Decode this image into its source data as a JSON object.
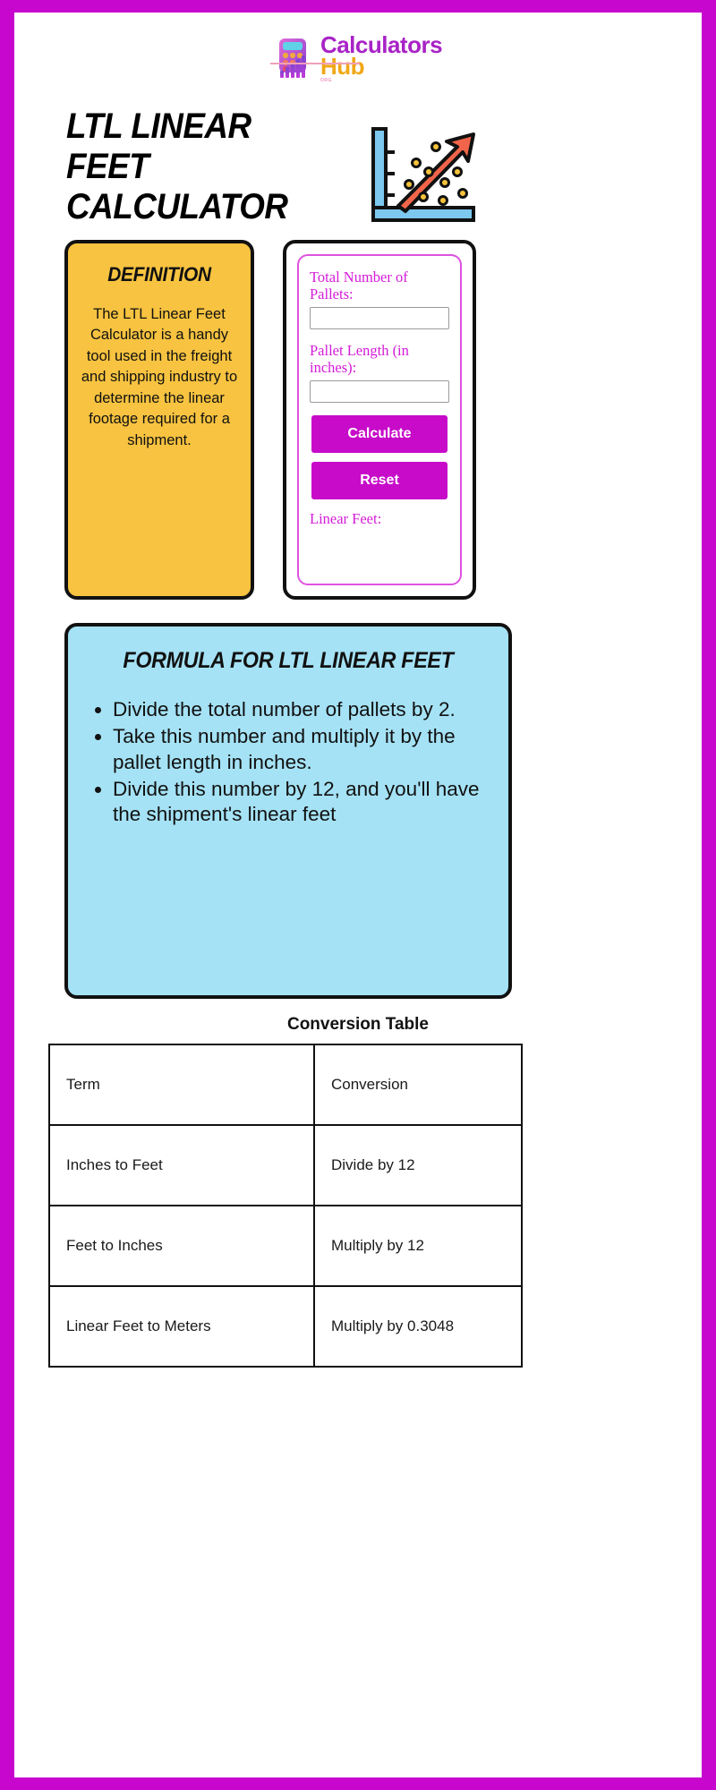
{
  "brand": {
    "name_line1": "Calculators",
    "name_line2": "Hub",
    "tagline": "ORG",
    "logo_icon": "calculator-bars-icon",
    "colors": {
      "purple": "#A823C6",
      "gold": "#F0A818",
      "frame": "#C707CE"
    }
  },
  "header": {
    "title": "LTL Linear Feet Calculator",
    "hero_icon": "scatter-plot-trend-arrow-icon"
  },
  "definition": {
    "heading": "Definition",
    "body": "The LTL Linear Feet Calculator is a handy tool used in the freight and shipping industry to determine the linear footage required for a shipment."
  },
  "calculator": {
    "fields": [
      {
        "label": "Total Number of Pallets:",
        "value": "",
        "placeholder": ""
      },
      {
        "label": "Pallet Length (in inches):",
        "value": "",
        "placeholder": ""
      }
    ],
    "calculate_label": "Calculate",
    "reset_label": "Reset",
    "result_label": "Linear Feet:",
    "result_value": "",
    "button_color": "#C70BC9",
    "label_color": "#D41BD8"
  },
  "formula": {
    "heading": "Formula for LTL Linear Feet",
    "steps": [
      "Divide the total number of pallets by 2.",
      "Take this number and multiply it by the pallet length in inches.",
      "Divide this number by 12, and you'll have the shipment's linear feet"
    ],
    "background": "#A5E2F5"
  },
  "conversion_table": {
    "title": "Conversion Table",
    "headers": [
      "Term",
      "Conversion"
    ],
    "rows": [
      [
        "Inches to Feet",
        "Divide by 12"
      ],
      [
        "Feet to Inches",
        "Multiply by 12"
      ],
      [
        "Linear Feet to Meters",
        "Multiply by 0.3048"
      ]
    ]
  }
}
